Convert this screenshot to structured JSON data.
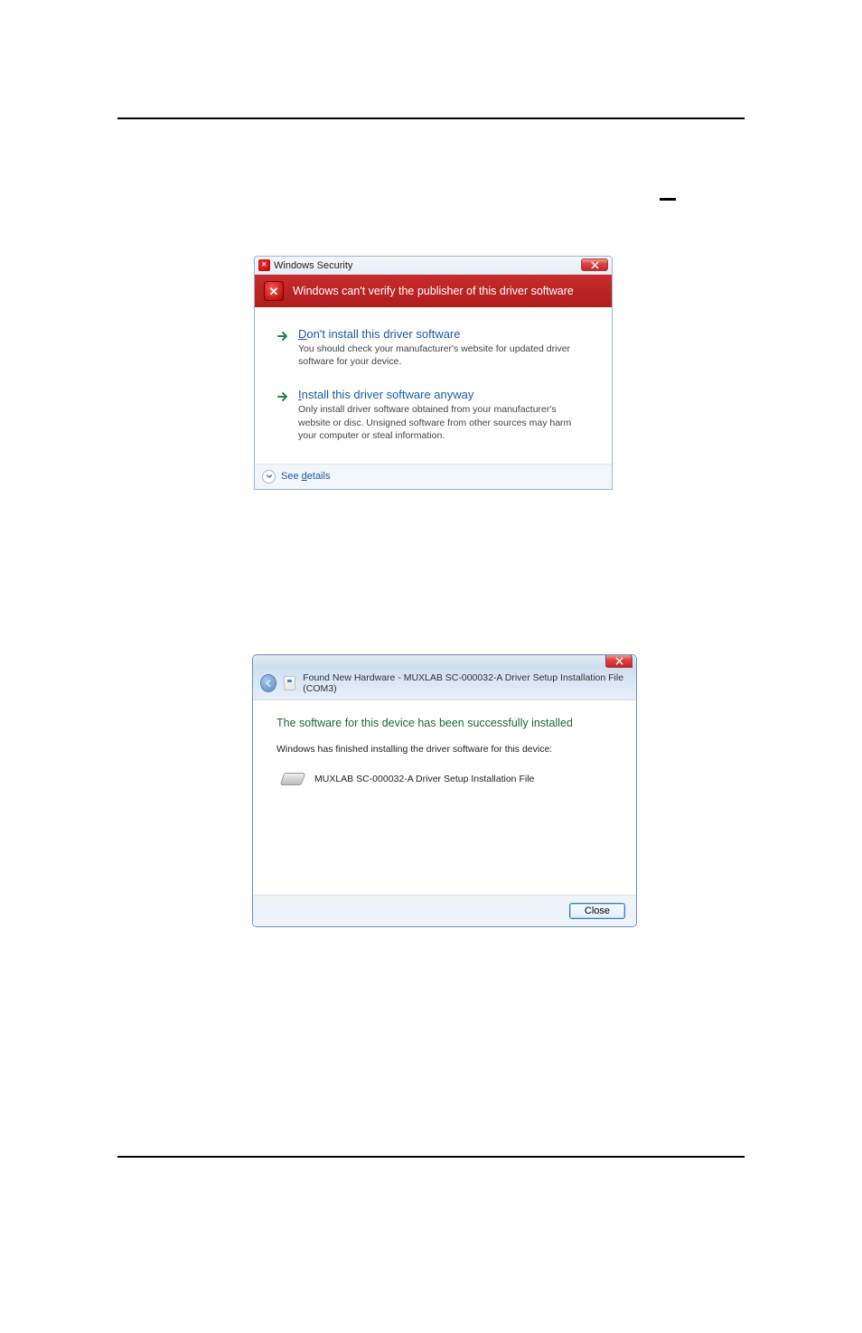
{
  "dialog1": {
    "title": "Windows Security",
    "banner": "Windows can't verify the publisher of this driver software",
    "options": [
      {
        "title_prefix": "D",
        "title_rest": "on't install this driver software",
        "desc": "You should check your manufacturer's website for updated driver software for your device."
      },
      {
        "title_prefix": "I",
        "title_rest": "nstall this driver software anyway",
        "desc": "Only install driver software obtained from your manufacturer's website or disc. Unsigned software from other sources may harm your computer or steal information."
      }
    ],
    "see_details_prefix": "See ",
    "see_details_ul": "d",
    "see_details_rest": "etails"
  },
  "dialog2": {
    "crumb": "Found New Hardware - MUXLAB SC-000032-A Driver Setup Installation File (COM3)",
    "heading": "The software for this device has been successfully installed",
    "line": "Windows has finished installing the driver software for this device:",
    "device": "MUXLAB SC-000032-A Driver Setup Installation File",
    "close": "Close"
  }
}
